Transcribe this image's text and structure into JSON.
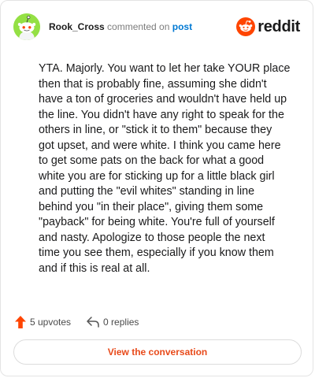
{
  "header": {
    "username": "Rook_Cross",
    "action_text": "commented on",
    "post_link": "post",
    "brand": "reddit"
  },
  "comment": {
    "text": "YTA. Majorly. You want to let her take YOUR place\nthen that is probably fine, assuming she didn't\nhave a ton of groceries and wouldn't have held up\nthe line. You didn't have any right to speak for the\nothers in line, or \"stick it to them\" because they\ngot upset, and were white. I think you came here\nto get some pats on the back for what a good\nwhite you are for sticking up for a little black girl\nand putting the \"evil whites\" standing in line\nbehind you \"in their place\", giving them some\n\"payback\" for being white. You're full of yourself\nand nasty. Apologize to those people the next\ntime you see them, especially if you know them\nand if this is real at all."
  },
  "actions": {
    "upvotes": "5 upvotes",
    "replies": "0 replies"
  },
  "cta": {
    "label": "View the conversation"
  },
  "colors": {
    "avatar_bg": "#94e044",
    "brand_orange": "#ff4500",
    "link_blue": "#0079d3",
    "upvote": "#ff4500",
    "cta_text": "#e84a1a"
  },
  "icons": [
    "snoo-avatar-icon",
    "reddit-logo-icon",
    "upvote-arrow-icon",
    "reply-arrow-icon"
  ]
}
